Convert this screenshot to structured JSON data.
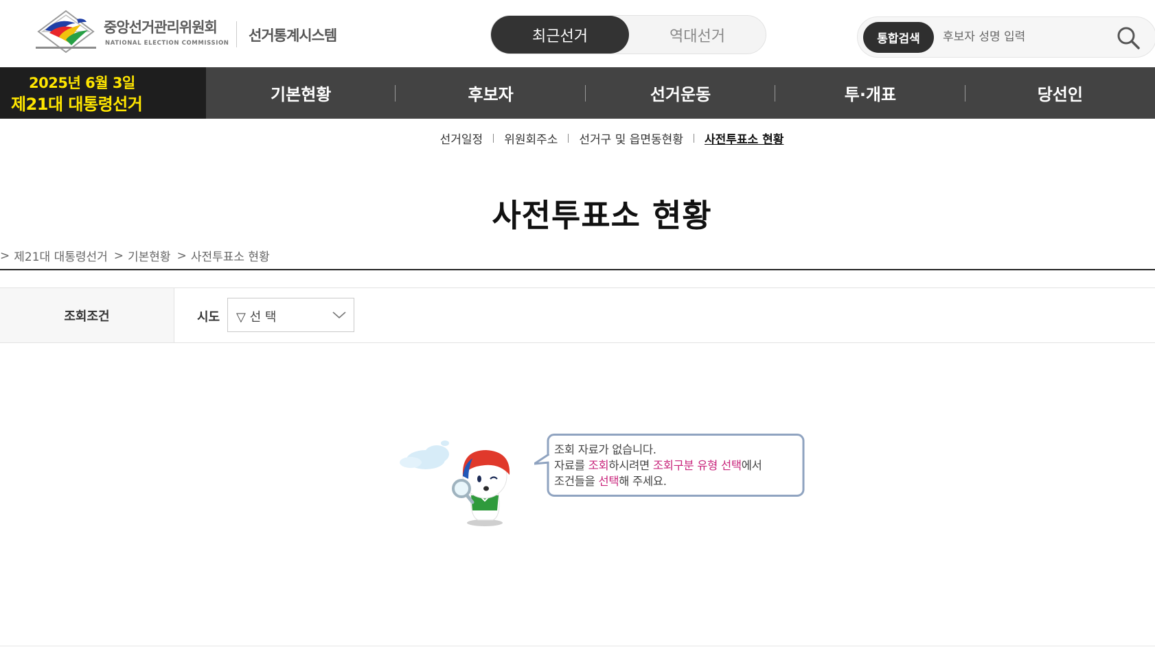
{
  "header": {
    "org_name": "중앙선거관리위원회",
    "org_name_en": "NATIONAL ELECTION COMMISSION",
    "system_name": "선거통계시스템",
    "toggle": {
      "recent": "최근선거",
      "past": "역대선거"
    },
    "search": {
      "badge": "통합검색",
      "placeholder": "후보자 성명 입력",
      "value": ""
    }
  },
  "election": {
    "date": "2025년 6월 3일",
    "name": "제21대 대통령선거"
  },
  "nav": {
    "items": [
      {
        "label": "기본현황"
      },
      {
        "label": "후보자"
      },
      {
        "label": "선거운동"
      },
      {
        "label": "투·개표"
      },
      {
        "label": "당선인"
      }
    ]
  },
  "subnav": {
    "items": [
      {
        "label": "선거일정"
      },
      {
        "label": "위원회주소"
      },
      {
        "label": "선거구 및 읍면동현황"
      },
      {
        "label": "사전투표소 현황",
        "active": true
      }
    ]
  },
  "page": {
    "title": "사전투표소 현황",
    "breadcrumb": [
      "제21대 대통령선거",
      "기본현황",
      "사전투표소 현황"
    ],
    "breadcrumb_sep": ">"
  },
  "filter": {
    "label": "조회조건",
    "sido_label": "시도",
    "sido_value": "▽ 선 택"
  },
  "empty": {
    "line1": "조회 자료가 없습니다.",
    "line2": {
      "a": "자료를 ",
      "b": "조회",
      "c": "하시려면 ",
      "d": "조회구분 유형 선택",
      "e": "에서"
    },
    "line3": {
      "a": "조건들을 ",
      "b": "선택",
      "c": "해 주세요."
    }
  },
  "colors": {
    "nav_bg": "#434343",
    "badge_bg": "#1e1e1e",
    "badge_text": "#ffe600",
    "highlight": "#c8247b",
    "bubble_border": "#8fa3c0"
  }
}
